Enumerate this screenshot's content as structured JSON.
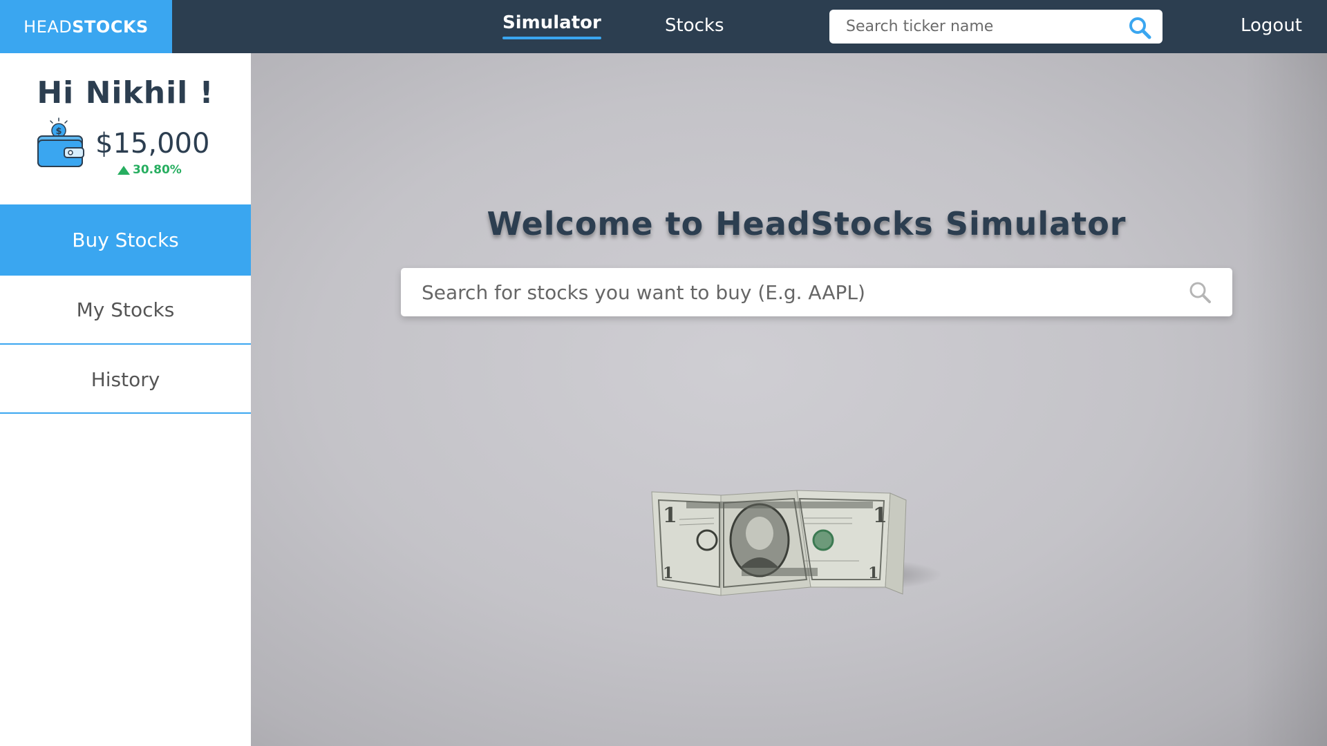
{
  "header": {
    "logo_light": "HEAD",
    "logo_bold": "STOCKS",
    "tabs": [
      {
        "label": "Simulator",
        "active": true
      },
      {
        "label": "Stocks",
        "active": false
      }
    ],
    "search_placeholder": "Search ticker name",
    "logout_label": "Logout"
  },
  "sidebar": {
    "greeting": "Hi Nikhil !",
    "balance": "$15,000",
    "change": "30.80%",
    "change_direction": "up",
    "menu": [
      {
        "label": "Buy Stocks",
        "active": true
      },
      {
        "label": "My Stocks",
        "active": false
      },
      {
        "label": "History",
        "active": false
      }
    ]
  },
  "main": {
    "title": "Welcome to HeadStocks Simulator",
    "search_placeholder": "Search for stocks you want to buy (E.g. AAPL)",
    "background_image": "folded-one-dollar-bill"
  },
  "colors": {
    "navy": "#2c3e50",
    "accent": "#3aa6f0",
    "positive": "#27ae60"
  }
}
